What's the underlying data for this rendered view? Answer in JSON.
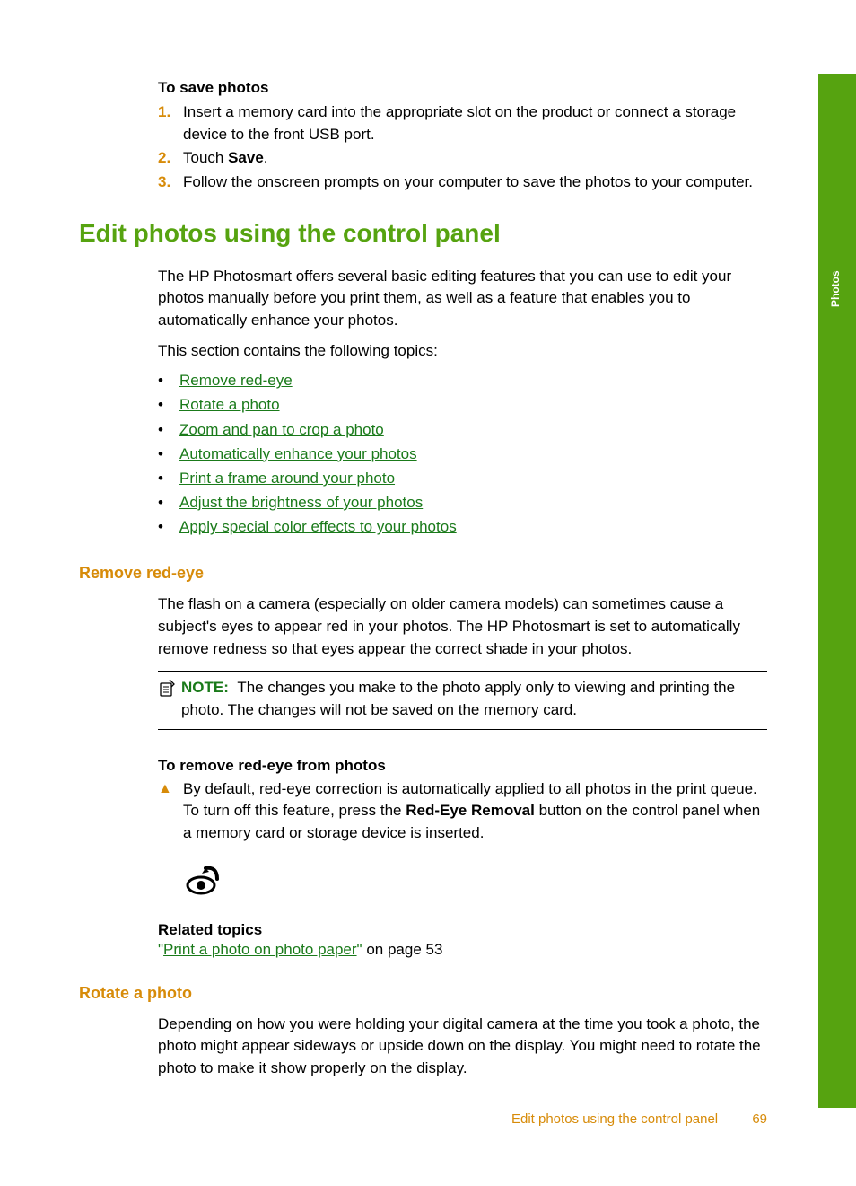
{
  "sideTab": "Photos",
  "savePhotos": {
    "title": "To save photos",
    "items": [
      {
        "num": "1.",
        "text": "Insert a memory card into the appropriate slot on the product or connect a storage device to the front USB port."
      },
      {
        "num": "2.",
        "prefix": "Touch ",
        "bold": "Save",
        "suffix": "."
      },
      {
        "num": "3.",
        "text": "Follow the onscreen prompts on your computer to save the photos to your computer."
      }
    ]
  },
  "h1": "Edit photos using the control panel",
  "intro": {
    "p1": "The HP Photosmart offers several basic editing features that you can use to edit your photos manually before you print them, as well as a feature that enables you to automatically enhance your photos.",
    "p2": "This section contains the following topics:"
  },
  "topics": [
    "Remove red-eye",
    "Rotate a photo",
    "Zoom and pan to crop a photo",
    "Automatically enhance your photos",
    "Print a frame around your photo",
    "Adjust the brightness of your photos",
    "Apply special color effects to your photos"
  ],
  "removeRedEye": {
    "heading": "Remove red-eye",
    "p1": "The flash on a camera (especially on older camera models) can sometimes cause a subject's eyes to appear red in your photos. The HP Photosmart is set to automatically remove redness so that eyes appear the correct shade in your photos.",
    "noteLabel": "NOTE:",
    "noteText": "The changes you make to the photo apply only to viewing and printing the photo. The changes will not be saved on the memory card.",
    "procTitle": "To remove red-eye from photos",
    "procPrefix": "By default, red-eye correction is automatically applied to all photos in the print queue. To turn off this feature, press the ",
    "procBold": "Red-Eye Removal",
    "procSuffix": " button on the control panel when a memory card or storage device is inserted.",
    "relatedTitle": "Related topics",
    "relatedLinkQuote": "\"",
    "relatedLinkText": "Print a photo on photo paper",
    "relatedLinkEnd": "\"",
    "relatedPage": " on page 53"
  },
  "rotate": {
    "heading": "Rotate a photo",
    "p1": "Depending on how you were holding your digital camera at the time you took a photo, the photo might appear sideways or upside down on the display. You might need to rotate the photo to make it show properly on the display."
  },
  "footer": {
    "title": "Edit photos using the control panel",
    "page": "69"
  }
}
